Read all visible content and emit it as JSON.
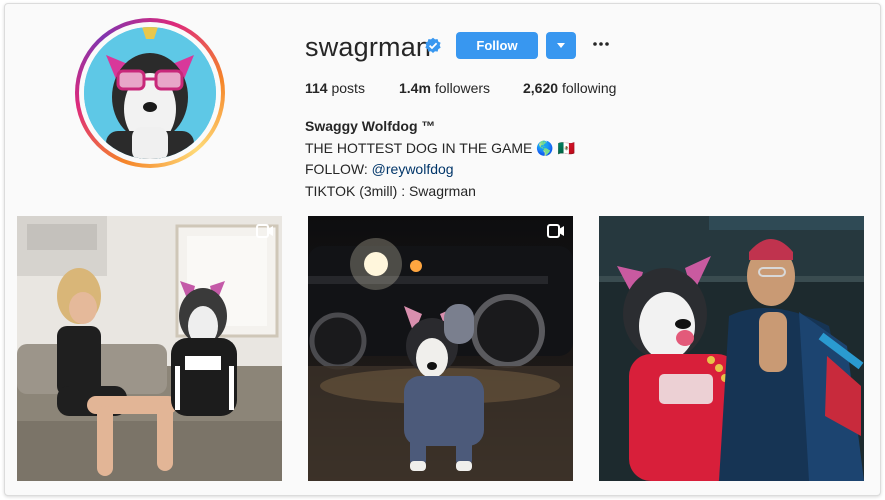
{
  "profile": {
    "username": "swagrman",
    "verified": true,
    "follow_label": "Follow",
    "stats": {
      "posts_value": "114",
      "posts_label": "posts",
      "followers_value": "1.4m",
      "followers_label": "followers",
      "following_value": "2,620",
      "following_label": "following"
    },
    "bio": {
      "full_name": "Swaggy Wolfdog ™",
      "line1": "THE HOTTEST DOG IN THE GAME 🌎 🇲🇽",
      "follow_prefix": "FOLLOW: ",
      "follow_handle": "@reywolfdog",
      "line4": "TIKTOK (3mill) : Swagrman"
    }
  },
  "posts": [
    {
      "type_icon": "video-icon"
    },
    {
      "type_icon": "video-icon"
    },
    {
      "type_icon": "none"
    }
  ],
  "colors": {
    "accent": "#3897f0",
    "link": "#003569",
    "verified": "#3897f0"
  }
}
